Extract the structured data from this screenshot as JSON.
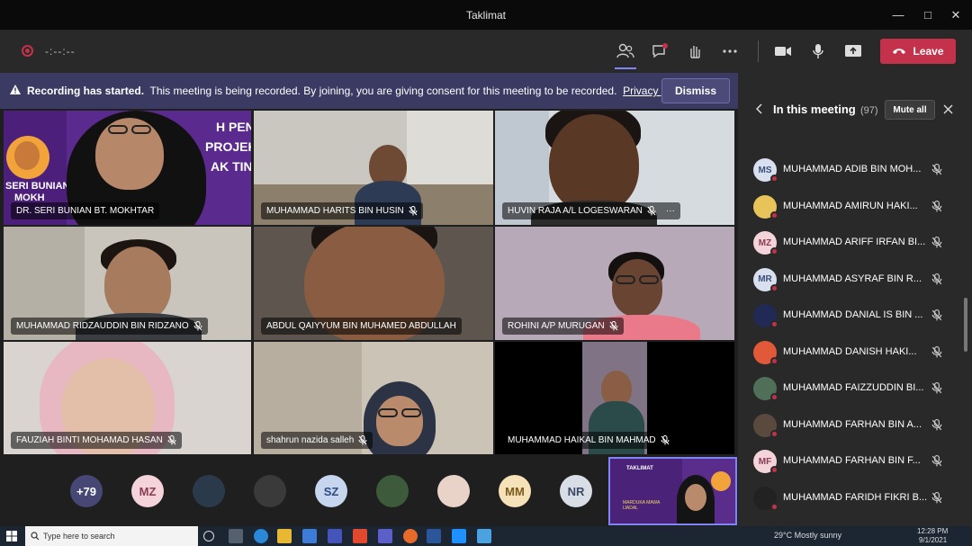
{
  "window": {
    "title": "Taklimat"
  },
  "toolbar": {
    "timer": "-:--:--",
    "leave_label": "Leave"
  },
  "banner": {
    "bold": "Recording has started.",
    "text": "This meeting is being recorded. By joining, you are giving consent for this meeting to be recorded.",
    "link": "Privacy policy",
    "dismiss_label": "Dismiss"
  },
  "tiles": [
    {
      "name": "DR. SERI BUNIAN BT. MOKHTAR",
      "muted": false
    },
    {
      "name": "MUHAMMAD HARITS BIN HUSIN",
      "muted": true
    },
    {
      "name": "HUVIN RAJA A/L LOGESWARAN",
      "muted": true
    },
    {
      "name": "MUHAMMAD RIDZAUDDIN BIN RIDZANO",
      "muted": true
    },
    {
      "name": "ABDUL QAIYYUM BIN MUHAMED ABDULLAH",
      "muted": false
    },
    {
      "name": "ROHINI A/P MURUGAN",
      "muted": true
    },
    {
      "name": "FAUZIAH BINTI MOHAMAD HASAN",
      "muted": true
    },
    {
      "name": "shahrun nazida salleh",
      "muted": true
    },
    {
      "name": "MUHAMMAD HAIKAL BIN MAHMAD",
      "muted": true
    }
  ],
  "slide": {
    "line1": "H PENULISAN",
    "line2": "PROJEK AKH",
    "line3": "AK TINGGI",
    "line4": "SERI BUNIAN",
    "line5": "MOKH"
  },
  "avatars": [
    {
      "initials": "+79",
      "color": "#464775",
      "fg": "#ffffff"
    },
    {
      "initials": "MZ",
      "color": "#f4d3db",
      "fg": "#8a3c55"
    },
    {
      "initials": "",
      "color": "#2b3a4a",
      "fg": "#ffffff"
    },
    {
      "initials": "",
      "color": "#3a3a3a",
      "fg": "#ffffff"
    },
    {
      "initials": "SZ",
      "color": "#c7d6ef",
      "fg": "#2b4c80"
    },
    {
      "initials": "",
      "color": "#3d5a3a",
      "fg": "#ffffff"
    },
    {
      "initials": "",
      "color": "#e9d3c9",
      "fg": "#ffffff"
    },
    {
      "initials": "MM",
      "color": "#f6e2b8",
      "fg": "#7a5a1d"
    },
    {
      "initials": "NR",
      "color": "#d8dde6",
      "fg": "#3b4a63"
    }
  ],
  "share_thumb": {
    "text1": "TAKLIMAT",
    "text2": "MARDUKA MAWA IJADAL"
  },
  "panel": {
    "title": "In this meeting",
    "count": "(97)",
    "mute_all_label": "Mute all",
    "participants": [
      {
        "name": "MUHAMMAD ADIB BIN MOH...",
        "initials": "MS",
        "color": "#d8dfef",
        "fg": "#3b4f7a"
      },
      {
        "name": "MUHAMMAD AMIRUN HAKI...",
        "initials": "",
        "color": "#e7c35a",
        "fg": "#ffffff"
      },
      {
        "name": "MUHAMMAD ARIFF IRFAN BI...",
        "initials": "MZ",
        "color": "#f4d3db",
        "fg": "#8a3c55"
      },
      {
        "name": "MUHAMMAD ASYRAF BIN R...",
        "initials": "MR",
        "color": "#d8dfef",
        "fg": "#3b4f7a"
      },
      {
        "name": "MUHAMMAD DANIAL IS BIN ...",
        "initials": "",
        "color": "#202a55",
        "fg": "#ffffff"
      },
      {
        "name": "MUHAMMAD DANISH HAKI...",
        "initials": "",
        "color": "#e05a3a",
        "fg": "#ffffff"
      },
      {
        "name": "MUHAMMAD FAIZZUDDIN BI...",
        "initials": "",
        "color": "#4f6f58",
        "fg": "#ffffff"
      },
      {
        "name": "MUHAMMAD FARHAN BIN A...",
        "initials": "",
        "color": "#5a4a3e",
        "fg": "#ffffff"
      },
      {
        "name": "MUHAMMAD FARHAN BIN F...",
        "initials": "MF",
        "color": "#f4d3db",
        "fg": "#8a3c55"
      },
      {
        "name": "MUHAMMAD FARIDH FIKRI B...",
        "initials": "",
        "color": "#222222",
        "fg": "#ffffff"
      }
    ]
  },
  "taskbar": {
    "search_placeholder": "Type here to search",
    "weather": "29°C  Mostly sunny",
    "time": "12:28 PM",
    "date": "9/1/2021"
  }
}
